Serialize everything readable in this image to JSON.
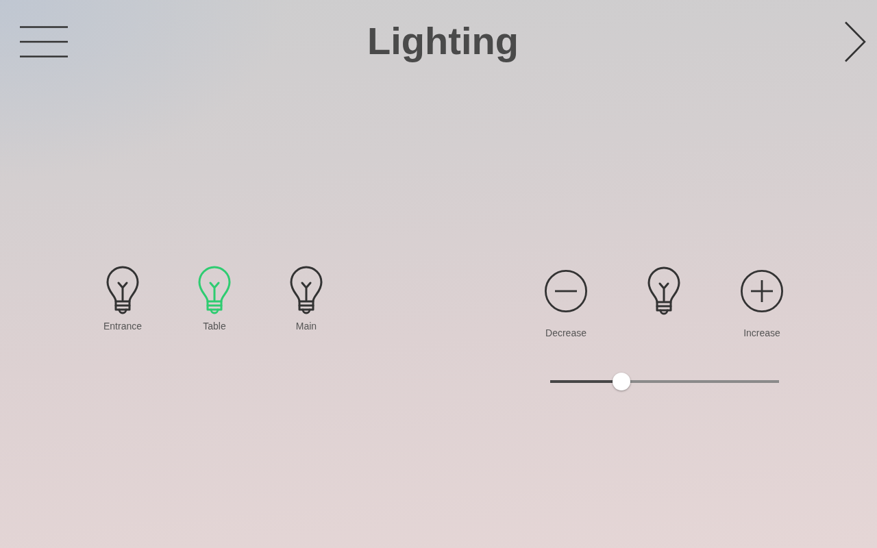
{
  "header": {
    "title": "Lighting"
  },
  "lights": [
    {
      "label": "Entrance",
      "on": false
    },
    {
      "label": "Table",
      "on": true
    },
    {
      "label": "Main",
      "on": false
    }
  ],
  "dimmer": {
    "decrease_label": "Decrease",
    "increase_label": "Increase",
    "level": 0.31
  }
}
